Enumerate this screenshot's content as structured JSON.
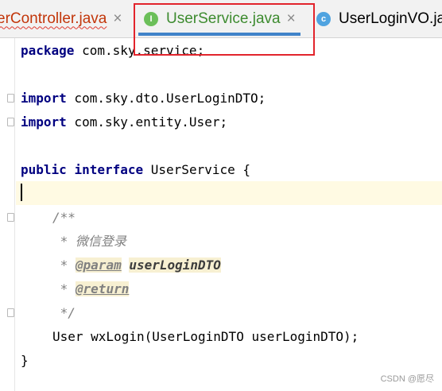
{
  "tabs": [
    {
      "label": "erController.java",
      "close": "×",
      "state": "error"
    },
    {
      "label": "UserService.java",
      "close": "×",
      "icon_letter": "I",
      "icon": "interface-icon",
      "state": "active"
    },
    {
      "label": "UserLoginVO.java",
      "icon_letter": "c",
      "icon": "class-icon",
      "state": "inactive"
    }
  ],
  "code": {
    "line1": {
      "kw": "package",
      "rest": " com.sky.service;"
    },
    "line3": {
      "kw": "import",
      "rest": " com.sky.dto.UserLoginDTO;"
    },
    "line4": {
      "kw": "import",
      "rest": " com.sky.entity.User;"
    },
    "line6": {
      "kw1": "public",
      "kw2": "interface",
      "rest": " UserService {"
    },
    "line8": "/**",
    "line9": " * 微信登录",
    "line10": {
      "prefix": " * ",
      "tag": "@param",
      "space": " ",
      "param": "userLoginDTO"
    },
    "line11": {
      "prefix": " * ",
      "tag": "@return"
    },
    "line12": " */",
    "line13": "User wxLogin(UserLoginDTO userLoginDTO);",
    "line14": "}"
  },
  "watermark": "CSDN @愿尽",
  "colors": {
    "keyword": "#000080",
    "comment": "#808080",
    "active_tab_underline": "#4083c9",
    "highlight_box": "#e2242c",
    "current_line": "#fffae3"
  }
}
